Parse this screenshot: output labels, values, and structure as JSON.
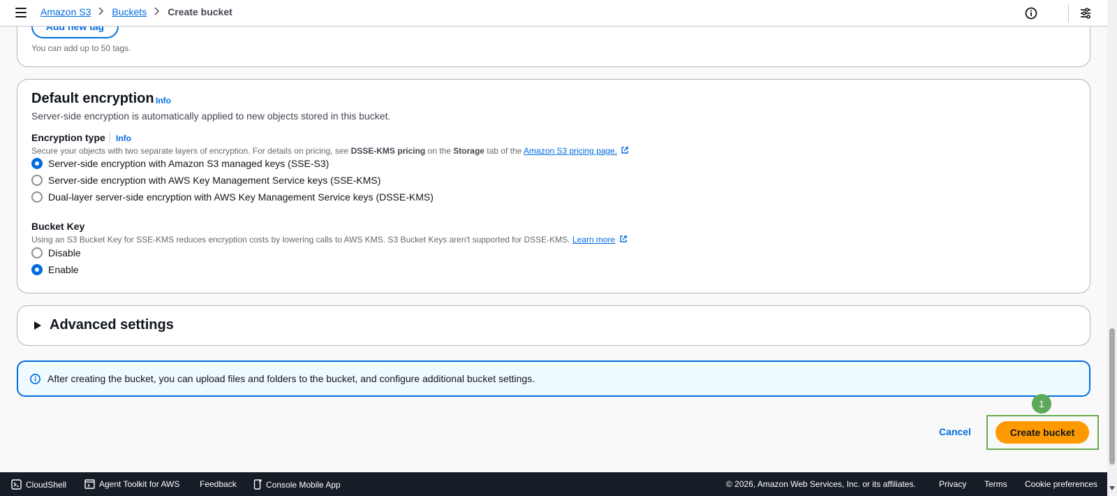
{
  "header": {
    "breadcrumb": [
      "Amazon S3",
      "Buckets",
      "Create bucket"
    ]
  },
  "tags": {
    "add_button": "Add new tag",
    "hint": "You can add up to 50 tags."
  },
  "default_encryption": {
    "title": "Default encryption",
    "info": "Info",
    "description": "Server-side encryption is automatically applied to new objects stored in this bucket.",
    "encryption_type": {
      "label": "Encryption type",
      "info": "Info",
      "desc_before": "Secure your objects with two separate layers of encryption. For details on pricing, see ",
      "desc_bold1": "DSSE-KMS pricing",
      "desc_mid": " on the ",
      "desc_bold2": "Storage",
      "desc_after": " tab of the ",
      "desc_link": "Amazon S3 pricing page.",
      "options": [
        {
          "label": "Server-side encryption with Amazon S3 managed keys (SSE-S3)",
          "checked": true
        },
        {
          "label": "Server-side encryption with AWS Key Management Service keys (SSE-KMS)",
          "checked": false
        },
        {
          "label": "Dual-layer server-side encryption with AWS Key Management Service keys (DSSE-KMS)",
          "checked": false
        }
      ]
    },
    "bucket_key": {
      "label": "Bucket Key",
      "desc": "Using an S3 Bucket Key for SSE-KMS reduces encryption costs by lowering calls to AWS KMS. S3 Bucket Keys aren't supported for DSSE-KMS. ",
      "desc_link": "Learn more",
      "options": [
        {
          "label": "Disable",
          "checked": false
        },
        {
          "label": "Enable",
          "checked": true
        }
      ]
    }
  },
  "advanced": {
    "title": "Advanced settings"
  },
  "alert": {
    "text": "After creating the bucket, you can upload files and folders to the bucket, and configure additional bucket settings."
  },
  "actions": {
    "cancel": "Cancel",
    "create": "Create bucket",
    "step_badge": "1"
  },
  "footer": {
    "cloudshell": "CloudShell",
    "agent_toolkit": "Agent Toolkit for AWS",
    "feedback": "Feedback",
    "mobile_app": "Console Mobile App",
    "copyright": "© 2026, Amazon Web Services, Inc. or its affiliates.",
    "privacy": "Privacy",
    "terms": "Terms",
    "cookie_preferences": "Cookie preferences"
  },
  "colors": {
    "primary": "#006ce0",
    "create_button": "#ff9900",
    "footer_bg": "#161d26",
    "highlight": "#6aaa4f"
  }
}
